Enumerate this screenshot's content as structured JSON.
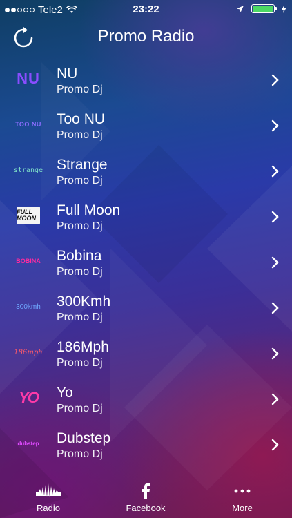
{
  "status_bar": {
    "signal_filled": 2,
    "signal_total": 5,
    "carrier": "Tele2",
    "time": "23:22",
    "battery_level": 0.95,
    "battery_color": "#4cd964"
  },
  "nav": {
    "title": "Promo Radio",
    "refresh_icon": "refresh-icon"
  },
  "stations": [
    {
      "name": "NU",
      "subtitle": "Promo Dj",
      "logo_text": "NU"
    },
    {
      "name": "Too NU",
      "subtitle": "Promo Dj",
      "logo_text": "TOO NU"
    },
    {
      "name": "Strange",
      "subtitle": "Promo Dj",
      "logo_text": "strange"
    },
    {
      "name": "Full Moon",
      "subtitle": "Promo Dj",
      "logo_text": "FULL MOON"
    },
    {
      "name": "Bobina",
      "subtitle": "Promo Dj",
      "logo_text": "BOBINA"
    },
    {
      "name": "300Kmh",
      "subtitle": "Promo Dj",
      "logo_text": "300kmh"
    },
    {
      "name": "186Mph",
      "subtitle": "Promo Dj",
      "logo_text": "186mph"
    },
    {
      "name": "Yo",
      "subtitle": "Promo Dj",
      "logo_text": "YO"
    },
    {
      "name": "Dubstep",
      "subtitle": "Promo Dj",
      "logo_text": "dubstep"
    }
  ],
  "tabs": [
    {
      "label": "Radio",
      "icon": "waveform-icon"
    },
    {
      "label": "Facebook",
      "icon": "facebook-icon"
    },
    {
      "label": "More",
      "icon": "more-dots-icon"
    }
  ]
}
